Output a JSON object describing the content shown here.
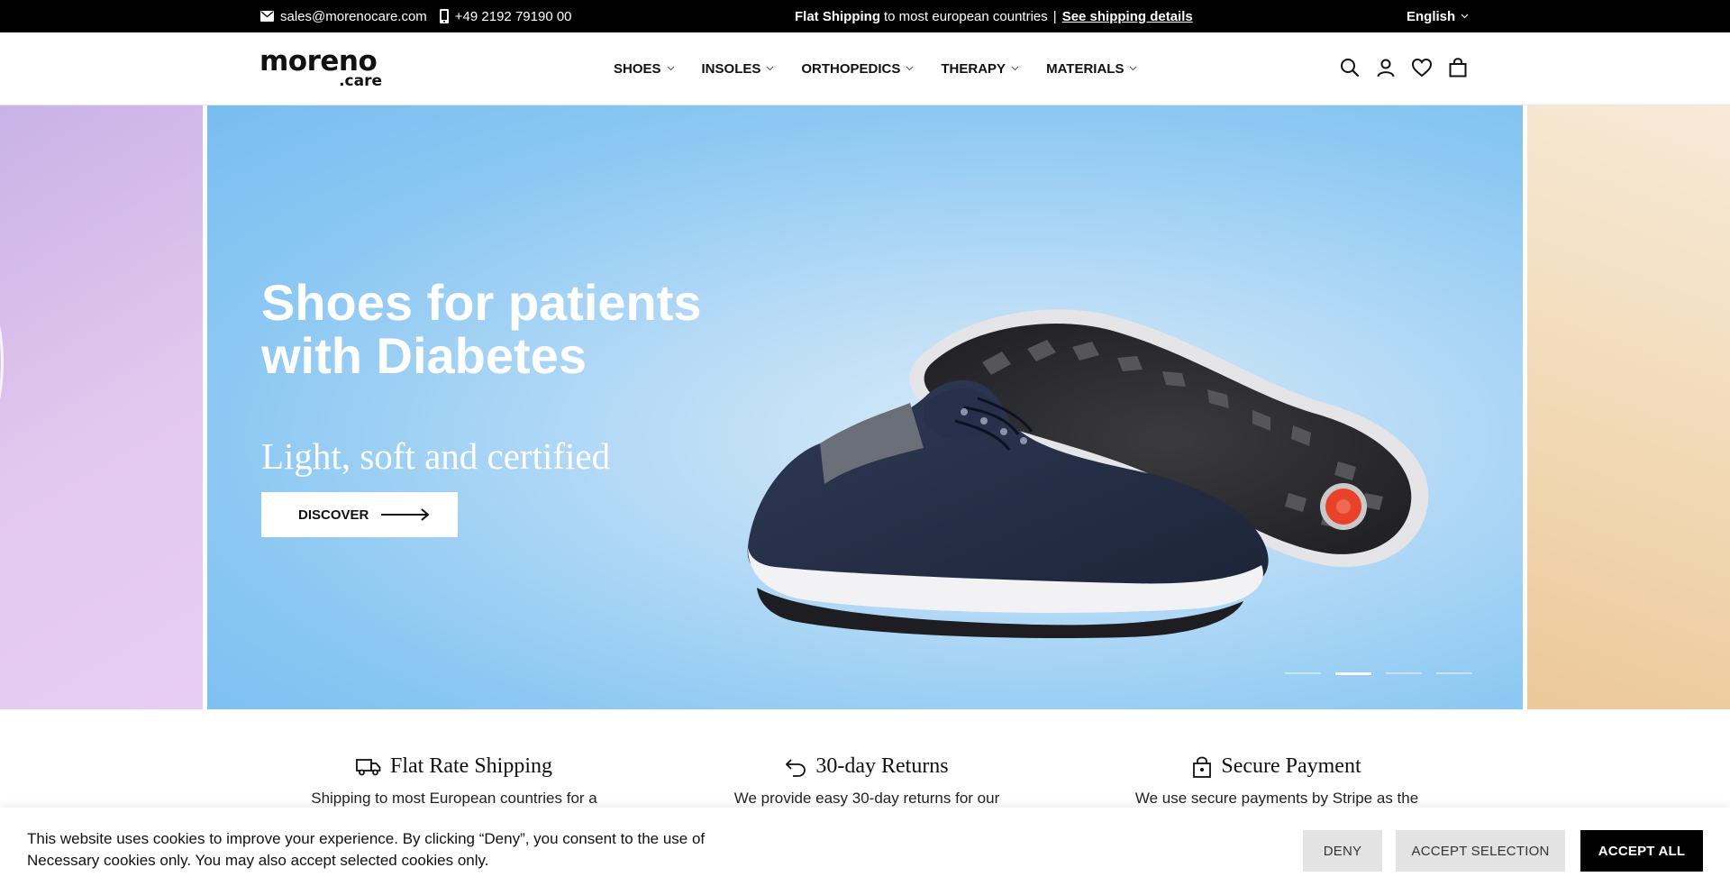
{
  "topbar": {
    "email": "sales@morenocare.com",
    "phone": "+49 2192 79190 00",
    "shipping_bold": "Flat Shipping",
    "shipping_text": "to most european countries",
    "separator": "|",
    "shipping_link": "See shipping details",
    "language": "English"
  },
  "header": {
    "logo_main": "moreno",
    "logo_sub": ".care",
    "nav": [
      {
        "label": "SHOES"
      },
      {
        "label": "INSOLES"
      },
      {
        "label": "ORTHOPEDICS"
      },
      {
        "label": "THERAPY"
      },
      {
        "label": "MATERIALS"
      }
    ],
    "icons": [
      "search-icon",
      "account-icon",
      "wishlist-icon",
      "cart-icon"
    ]
  },
  "hero": {
    "title": "Shoes for patients with Diabetes",
    "subtitle": "Light, soft and certified",
    "button_label": "DISCOVER",
    "slide_count": 4,
    "active_slide": 2
  },
  "features": [
    {
      "icon": "truck-icon",
      "title": "Flat Rate Shipping",
      "text": "Shipping to most European countries for a"
    },
    {
      "icon": "return-icon",
      "title": "30-day Returns",
      "text": "We provide easy 30-day returns for our"
    },
    {
      "icon": "lock-icon",
      "title": "Secure Payment",
      "text": "We use secure payments by Stripe as the"
    }
  ],
  "cookie": {
    "text": "This website uses cookies to improve your experience. By clicking “Deny”, you consent to the use of Necessary cookies only. You may also accept selected cookies only.",
    "deny": "DENY",
    "accept_selection": "ACCEPT SELECTION",
    "accept_all": "ACCEPT ALL"
  },
  "colors": {
    "topbar_bg": "#000000",
    "hero_blue": "#8cc8f3",
    "accent_black": "#000000"
  }
}
